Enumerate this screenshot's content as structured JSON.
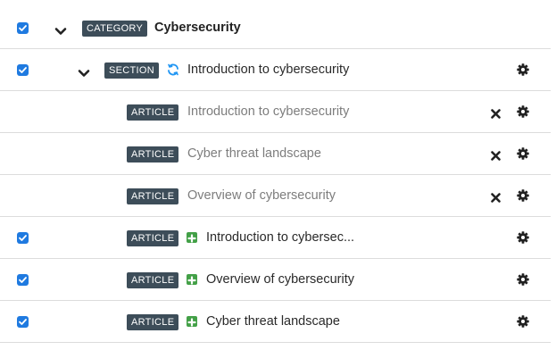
{
  "colors": {
    "checkbox": "#1f7ae0",
    "badge_bg": "#3d4d59",
    "badge_text": "#ffffff",
    "plus": "#43a047",
    "sync": "#2196f3",
    "icon_dark": "#222222",
    "muted_text": "#7d7d7d"
  },
  "rows": [
    {
      "checked": true,
      "chevron": "chevron-down-icon",
      "badge": "CATEGORY",
      "title": "Cybersecurity"
    },
    {
      "checked": true,
      "chevron": "chevron-down-icon",
      "badge": "SECTION",
      "status_icon": "sync-icon",
      "title": "Introduction to cybersecurity",
      "actions": [
        "gear-icon"
      ]
    },
    {
      "checked": false,
      "badge": "ARTICLE",
      "title": "Introduction to cybersecurity",
      "muted": true,
      "actions": [
        "close-icon",
        "gear-icon"
      ]
    },
    {
      "checked": false,
      "badge": "ARTICLE",
      "title": "Cyber threat landscape",
      "muted": true,
      "actions": [
        "close-icon",
        "gear-icon"
      ]
    },
    {
      "checked": false,
      "badge": "ARTICLE",
      "title": "Overview of cybersecurity",
      "muted": true,
      "actions": [
        "close-icon",
        "gear-icon"
      ]
    },
    {
      "checked": true,
      "badge": "ARTICLE",
      "status_icon": "plus-icon",
      "title": "Introduction to cybersec...",
      "actions": [
        "gear-icon"
      ]
    },
    {
      "checked": true,
      "badge": "ARTICLE",
      "status_icon": "plus-icon",
      "title": "Overview of cybersecurity",
      "actions": [
        "gear-icon"
      ]
    },
    {
      "checked": true,
      "badge": "ARTICLE",
      "status_icon": "plus-icon",
      "title": "Cyber threat landscape",
      "actions": [
        "gear-icon"
      ]
    }
  ]
}
